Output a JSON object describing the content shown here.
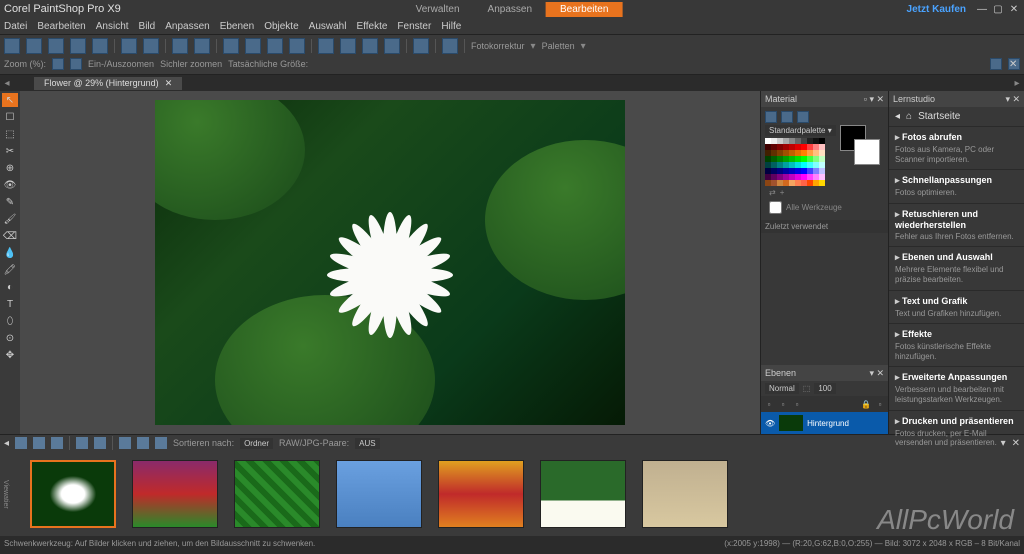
{
  "app": {
    "title": "Corel PaintShop Pro X9"
  },
  "header_tabs": {
    "manage": "Verwalten",
    "adjust": "Anpassen",
    "edit": "Bearbeiten"
  },
  "buy": "Jetzt Kaufen",
  "menu": [
    "Datei",
    "Bearbeiten",
    "Ansicht",
    "Bild",
    "Anpassen",
    "Ebenen",
    "Objekte",
    "Auswahl",
    "Effekte",
    "Fenster",
    "Hilfe"
  ],
  "toolbar_labels": {
    "zoom": "Zoom (%):",
    "autosize": "Ein-/Auszoomen",
    "smartzoom": "Sichler zoomen",
    "actualsize": "Tatsächliche Größe:",
    "photofix": "Fotokorrektur",
    "palettes": "Paletten"
  },
  "document": {
    "tab": "Flower @  29% (Hintergrund)"
  },
  "panels": {
    "material": {
      "title": "Material",
      "palette": "Standardpalette",
      "all_tools": "Alle Werkzeuge",
      "recent": "Zuletzt verwendet"
    },
    "layers": {
      "title": "Ebenen",
      "mode": "Normal",
      "opacity": "100",
      "layer_name": "Hintergrund"
    },
    "learn": {
      "title": "Lernstudio",
      "home": "Startseite",
      "items": [
        {
          "t": "Fotos abrufen",
          "d": "Fotos aus Kamera, PC oder Scanner importieren."
        },
        {
          "t": "Schnellanpassungen",
          "d": "Fotos optimieren."
        },
        {
          "t": "Retuschieren und wiederherstellen",
          "d": "Fehler aus Ihren Fotos entfernen."
        },
        {
          "t": "Ebenen und Auswahl",
          "d": "Mehrere Elemente flexibel und präzise bearbeiten."
        },
        {
          "t": "Text und Grafik",
          "d": "Text und Grafiken hinzufügen."
        },
        {
          "t": "Effekte",
          "d": "Fotos künstlerische Effekte hinzufügen."
        },
        {
          "t": "Erweiterte Anpassungen",
          "d": "Verbessern und bearbeiten mit leistungsstarken Werkzeugen."
        },
        {
          "t": "Drucken und präsentieren",
          "d": "Fotos drucken, per E-Mail versenden und präsentieren."
        }
      ]
    }
  },
  "organizer": {
    "sort_label": "Sortieren nach:",
    "sort_by": "Ordner",
    "pair": "RAW/JPG-Paare:",
    "pair_val": "AUS",
    "viewer": "Viewatier"
  },
  "status": {
    "left": "Schwenkwerkzeug: Auf Bilder klicken und ziehen, um den Bildausschnitt zu schwenken.",
    "right": "(x:2005 y:1998) — (R:20,G:62,B:0,O:255) — Bild:  3072 x 2048 x RGB – 8  Bit/Kanal"
  },
  "watermark": "AllPcWorld",
  "palette_colors": [
    "#ffffff",
    "#eeeeee",
    "#cccccc",
    "#aaaaaa",
    "#888888",
    "#666666",
    "#444444",
    "#222222",
    "#111111",
    "#000000",
    "#400000",
    "#600000",
    "#800000",
    "#a00000",
    "#c00000",
    "#e00000",
    "#ff0000",
    "#ff4040",
    "#ff8080",
    "#ffc0c0",
    "#402000",
    "#603000",
    "#804000",
    "#a05000",
    "#c06000",
    "#e07000",
    "#ff8000",
    "#ffa040",
    "#ffc080",
    "#ffe0c0",
    "#004000",
    "#006000",
    "#008000",
    "#00a000",
    "#00c000",
    "#00e000",
    "#00ff00",
    "#40ff40",
    "#80ff80",
    "#c0ffc0",
    "#004040",
    "#006060",
    "#008080",
    "#00a0a0",
    "#00c0c0",
    "#00e0e0",
    "#00ffff",
    "#40ffff",
    "#80ffff",
    "#c0ffff",
    "#000040",
    "#000060",
    "#000080",
    "#0000a0",
    "#0000c0",
    "#0000e0",
    "#0000ff",
    "#4040ff",
    "#8080ff",
    "#c0c0ff",
    "#400040",
    "#600060",
    "#800080",
    "#a000a0",
    "#c000c0",
    "#e000e0",
    "#ff00ff",
    "#ff40ff",
    "#ff80ff",
    "#ffc0ff",
    "#8b4513",
    "#a0522d",
    "#cd853f",
    "#d2691e",
    "#f4a460",
    "#ff7f50",
    "#ff6347",
    "#ff4500",
    "#ffa500",
    "#ffd700"
  ],
  "thumbs": [
    {
      "bg": "radial-gradient(#fff 20%, #0a3a0a 40%)"
    },
    {
      "bg": "linear-gradient(#8a2a6a,#c02a2a,#2a8a2a)"
    },
    {
      "bg": "repeating-linear-gradient(45deg,#2a8a2a 0 6px,#1a6a1a 6px 12px)"
    },
    {
      "bg": "linear-gradient(#6aa0e0,#4a80c0)"
    },
    {
      "bg": "linear-gradient(#e0a020,#c02a2a,#e08020)"
    },
    {
      "bg": "linear-gradient(#2a6a2a 60%,#fafaf0 60%)"
    },
    {
      "bg": "linear-gradient(#c0b090,#d8c8a0)"
    }
  ],
  "tools": [
    "↖",
    "☐",
    "⬚",
    "✂",
    "⊕",
    "👁",
    "✎",
    "🖌",
    "⌫",
    "💧",
    "🖍",
    "◐",
    "T",
    "⬯",
    "⊙",
    "✥"
  ]
}
